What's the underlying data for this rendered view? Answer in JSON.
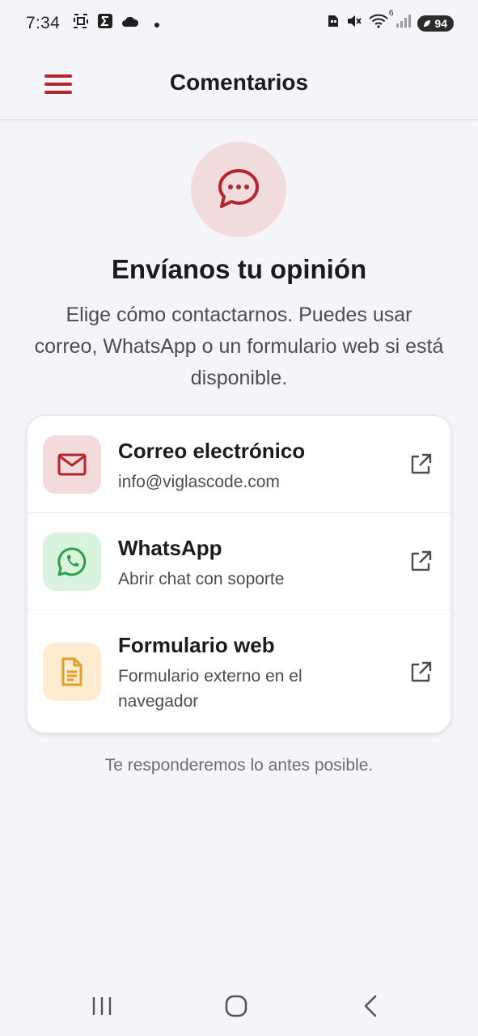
{
  "status_bar": {
    "time": "7:34",
    "battery": "94",
    "icons": [
      "screenshot-icon",
      "sigma-icon",
      "cloud-icon",
      "dot-icon",
      "sim-icon",
      "mute-icon",
      "wifi-icon",
      "signal-icon"
    ],
    "wifi_badge": "6"
  },
  "app_bar": {
    "title": "Comentarios",
    "menu_icon": "hamburger-menu-icon",
    "accent": "#b3262d"
  },
  "hero": {
    "icon": "chat-bubble-icon",
    "title": "Envíanos tu opinión",
    "description": "Elige cómo contactarnos. Puedes usar correo, WhatsApp o un formulario web si está disponible."
  },
  "options": [
    {
      "title": "Correo electrónico",
      "subtitle": "info@viglascode.com",
      "icon": "mail-icon",
      "action_icon": "open-external-icon",
      "color": "#b3262d"
    },
    {
      "title": "WhatsApp",
      "subtitle": "Abrir chat con soporte",
      "icon": "whatsapp-icon",
      "action_icon": "open-external-icon",
      "color": "#25a244"
    },
    {
      "title": "Formulario web",
      "subtitle": "Formulario externo en el navegador",
      "icon": "document-icon",
      "action_icon": "open-external-icon",
      "color": "#e0a022"
    }
  ],
  "footer": {
    "note": "Te responderemos lo antes posible."
  },
  "nav_bar": {
    "buttons": [
      "recent-apps-icon",
      "home-icon",
      "back-icon"
    ]
  }
}
